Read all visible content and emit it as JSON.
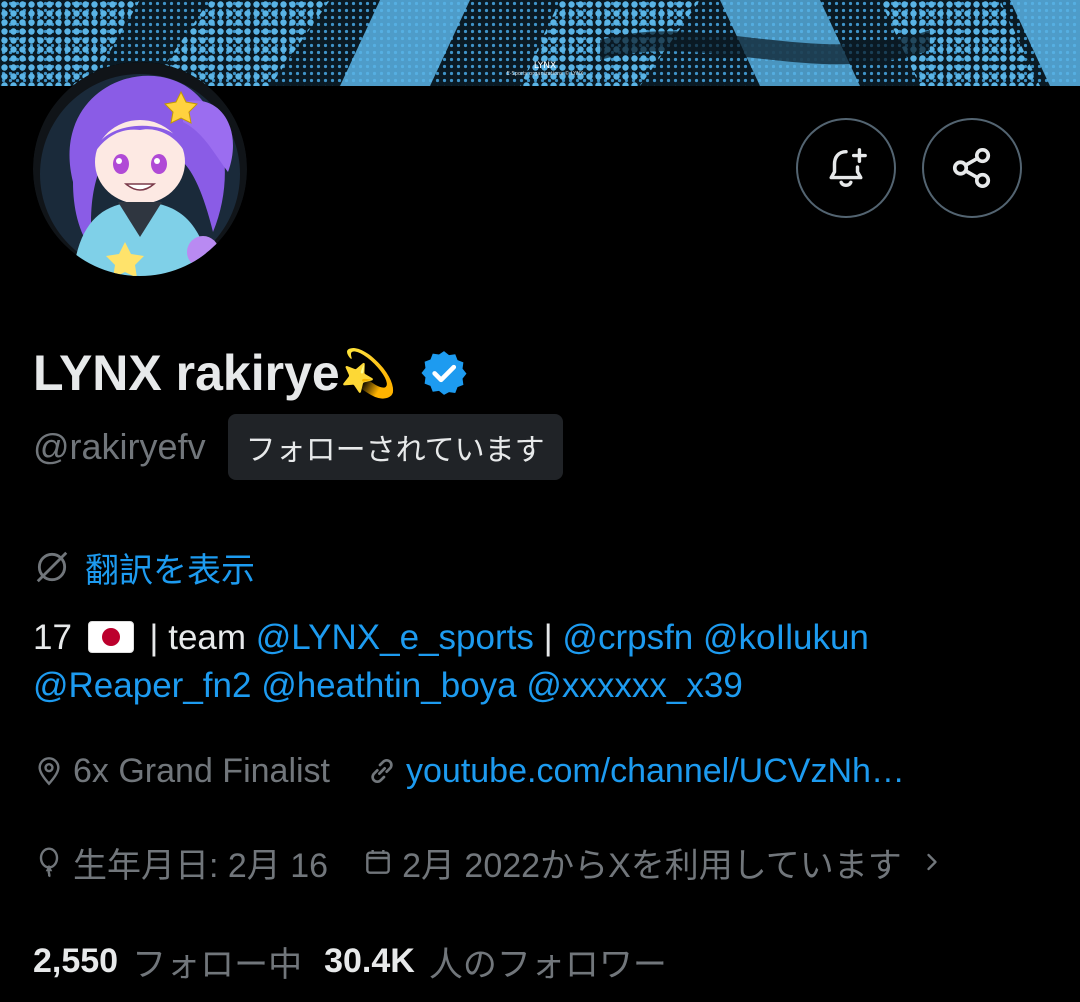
{
  "banner": {
    "logo_text": "LYNX",
    "logo_subtext": "E-Sports organizations © LYNX"
  },
  "profile": {
    "display_name": "LYNX rakirye",
    "name_emoji": "💫",
    "handle": "@rakiryefv",
    "follows_you_label": "フォローされています"
  },
  "actions": {
    "notify_icon": "bell-plus-icon",
    "share_icon": "share-icon"
  },
  "translate": {
    "label": "翻訳を表示",
    "icon": "globe-slash-icon"
  },
  "bio": {
    "age": "17",
    "flag": "Japan flag",
    "sep1": "| team",
    "team_mention": "@LYNX_e_sports",
    "sep2": "|",
    "mentions": [
      "@crpsfn",
      "@koIlukun",
      "@Reaper_fn2",
      "@heathtin_boya",
      "@xxxxxx_x39"
    ]
  },
  "meta": {
    "location": "6x Grand Finalist",
    "link": "youtube.com/channel/UCVzNh…",
    "birthday": "生年月日: 2月 16",
    "joined": "2月 2022からXを利用しています"
  },
  "stats": {
    "following_count": "2,550",
    "following_label": "フォロー中",
    "followers_count": "30.4K",
    "followers_label": "人のフォロワー"
  },
  "colors": {
    "accent": "#1d9bf0",
    "muted": "#71767b",
    "text": "#e7e9ea",
    "background": "#000000"
  }
}
